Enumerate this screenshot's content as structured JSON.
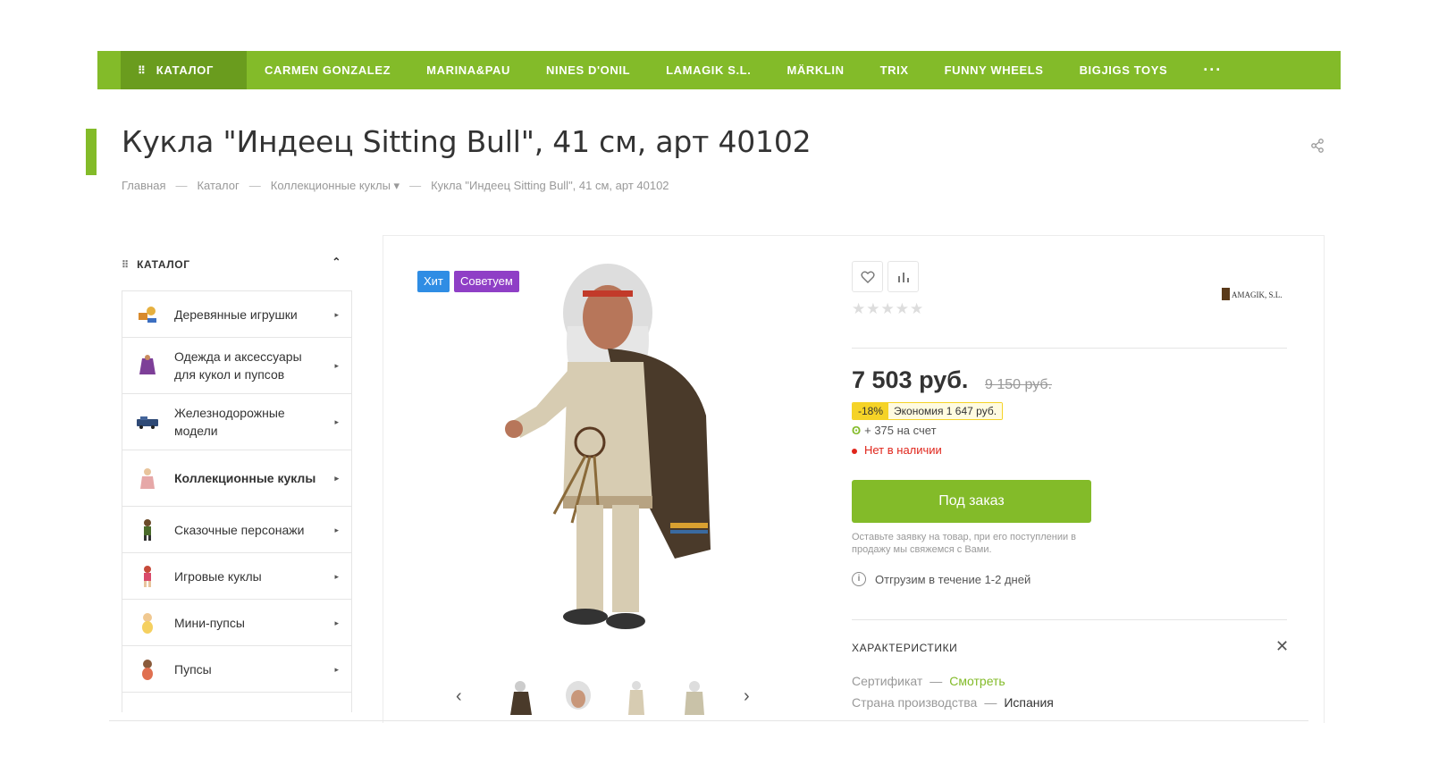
{
  "topnav": {
    "catalog_icon": "⠿",
    "catalog_label": "КАТАЛОГ",
    "items": [
      "CARMEN GONZALEZ",
      "MARINA&PAU",
      "NINES D'ONIL",
      "LAMAGIK S.L.",
      "MÄRKLIN",
      "TRIX",
      "FUNNY WHEELS",
      "BIGJIGS TOYS"
    ],
    "more": "···"
  },
  "page": {
    "title": "Кукла \"Индеец Sitting Bull\", 41 см, арт 40102"
  },
  "breadcrumb": {
    "items": [
      "Главная",
      "Каталог",
      "Коллекционные куклы ▾",
      "Кукла \"Индеец Sitting Bull\", 41 см, арт 40102"
    ],
    "separator": "—"
  },
  "sidebar": {
    "grid_icon": "⠿",
    "heading": "КАТАЛОГ",
    "collapse_icon": "⌃",
    "items": [
      {
        "label": "Деревянные игрушки",
        "icon": "wooden-toys-icon"
      },
      {
        "label": "Одежда и аксессуары для кукол и пупсов",
        "icon": "doll-clothes-icon"
      },
      {
        "label": "Железнодорожные модели",
        "icon": "train-icon"
      },
      {
        "label": "Коллекционные куклы",
        "icon": "collectible-doll-icon"
      },
      {
        "label": "Сказочные персонажи",
        "icon": "fairy-character-icon"
      },
      {
        "label": "Игровые куклы",
        "icon": "play-doll-icon"
      },
      {
        "label": "Мини-пупсы",
        "icon": "mini-baby-icon"
      },
      {
        "label": "Пупсы",
        "icon": "baby-doll-icon"
      }
    ],
    "arrow": "▸"
  },
  "product": {
    "badges": [
      "Хит",
      "Советуем"
    ],
    "badge_colors": {
      "hit": "#2f8de4",
      "recommend": "#8f3fc6"
    },
    "stars": "★★★★★",
    "rating": 0,
    "brand": "LAMAGIK, S.L.",
    "price": "7 503 руб.",
    "old_price": "9 150 руб.",
    "discount_pct": "-18%",
    "saving": "Экономия 1 647 руб.",
    "bonus": "+ 375 на счет",
    "stock": "Нет в наличии",
    "order_button": "Под заказ",
    "order_note": "Оставьте заявку на товар, при его поступлении в продажу мы свяжемся с Вами.",
    "shipping": "Отгрузим в течение 1-2 дней",
    "gallery": {
      "prev": "‹",
      "next": "›",
      "thumbs": 4
    }
  },
  "characteristics": {
    "heading": "ХАРАКТЕРИСТИКИ",
    "close": "✕",
    "rows": [
      {
        "key": "Сертификат",
        "value": "Смотреть",
        "link": true
      },
      {
        "key": "Страна производства",
        "value": "Испания",
        "link": false
      }
    ],
    "dash": "—"
  },
  "colors": {
    "accent": "#83bb29",
    "accent_dark": "#6a9c1e",
    "danger": "#e0251b"
  }
}
